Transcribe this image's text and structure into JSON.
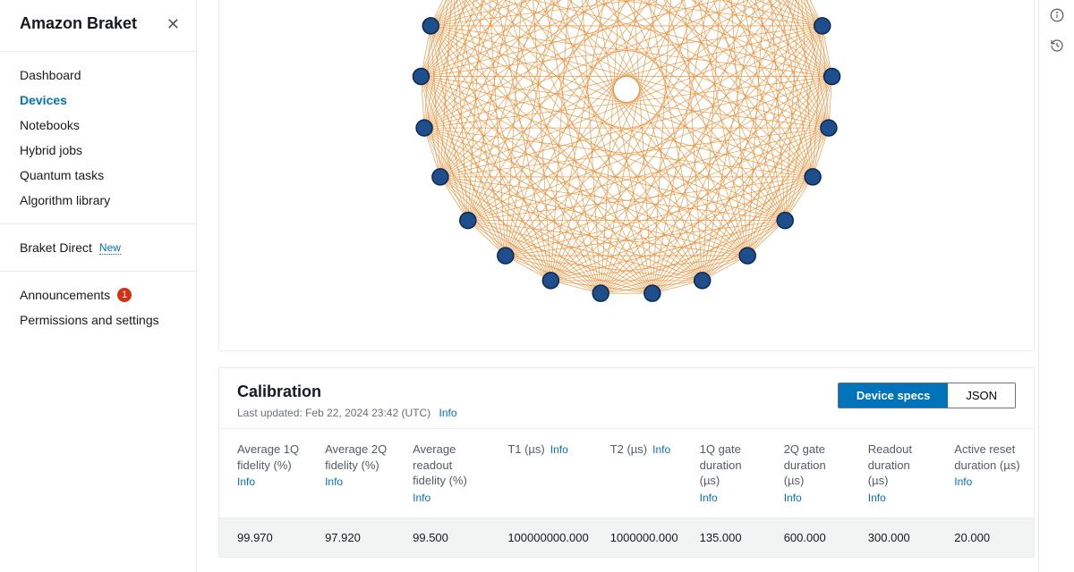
{
  "sidebar": {
    "title": "Amazon Braket",
    "items": [
      {
        "label": "Dashboard"
      },
      {
        "label": "Devices"
      },
      {
        "label": "Notebooks"
      },
      {
        "label": "Hybrid jobs"
      },
      {
        "label": "Quantum tasks"
      },
      {
        "label": "Algorithm library"
      }
    ],
    "direct": {
      "label": "Braket Direct",
      "badge": "New"
    },
    "announcements": {
      "label": "Announcements",
      "count": "1"
    },
    "permissions": {
      "label": "Permissions and settings"
    }
  },
  "graph": {
    "node_count": 25
  },
  "calibration": {
    "title": "Calibration",
    "last_updated_prefix": "Last updated: ",
    "last_updated": "Feb 22, 2024 23:42 (UTC)",
    "info": "Info",
    "toggle": {
      "specs": "Device specs",
      "json": "JSON"
    },
    "columns": [
      "Average 1Q fidelity (%)",
      "Average 2Q fidelity (%)",
      "Average readout fidelity (%)",
      "T1 (µs)",
      "T2 (µs)",
      "1Q gate duration (µs)",
      "2Q gate duration (µs)",
      "Readout duration (µs)",
      "Active reset duration (µs)"
    ],
    "row": [
      "99.970",
      "97.920",
      "99.500",
      "100000000.000",
      "1000000.000",
      "135.000",
      "600.000",
      "300.000",
      "20.000"
    ]
  }
}
